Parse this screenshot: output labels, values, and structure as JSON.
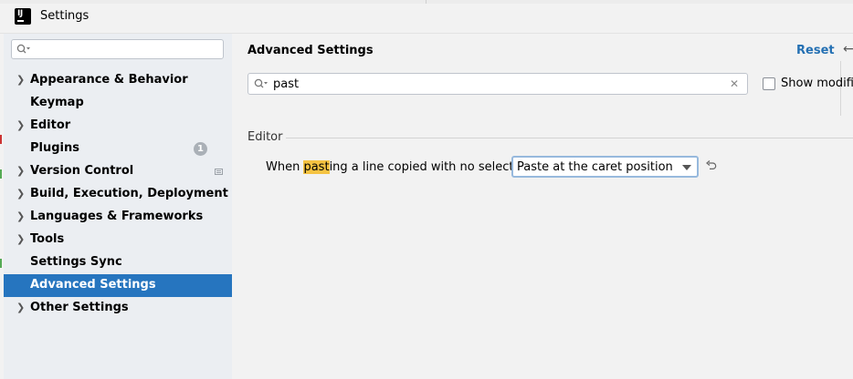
{
  "window": {
    "title": "Settings",
    "app_icon": "intellij-idea-icon"
  },
  "sidebar": {
    "search": {
      "value": "",
      "placeholder": ""
    },
    "items": [
      {
        "label": "Appearance & Behavior",
        "expandable": true
      },
      {
        "label": "Keymap",
        "expandable": false
      },
      {
        "label": "Editor",
        "expandable": true
      },
      {
        "label": "Plugins",
        "expandable": false,
        "badge": "1"
      },
      {
        "label": "Version Control",
        "expandable": true,
        "icon": "project-level-icon"
      },
      {
        "label": "Build, Execution, Deployment",
        "expandable": true
      },
      {
        "label": "Languages & Frameworks",
        "expandable": true
      },
      {
        "label": "Tools",
        "expandable": true
      },
      {
        "label": "Settings Sync",
        "expandable": false
      },
      {
        "label": "Advanced Settings",
        "expandable": false,
        "selected": true
      },
      {
        "label": "Other Settings",
        "expandable": true
      }
    ],
    "selected_color": "#2675bf"
  },
  "main": {
    "title": "Advanced Settings",
    "reset_label": "Reset",
    "filter": {
      "value": "past"
    },
    "show_modified_label": "Show modifie",
    "show_modified_checked": false,
    "section": "Editor",
    "setting": {
      "label_prefix": "When ",
      "label_highlight": "past",
      "label_suffix": "ing a line copied with no selection:",
      "value": "Paste at the caret position"
    },
    "accent_color": "#2470b3",
    "highlight_color": "#f5c342"
  }
}
